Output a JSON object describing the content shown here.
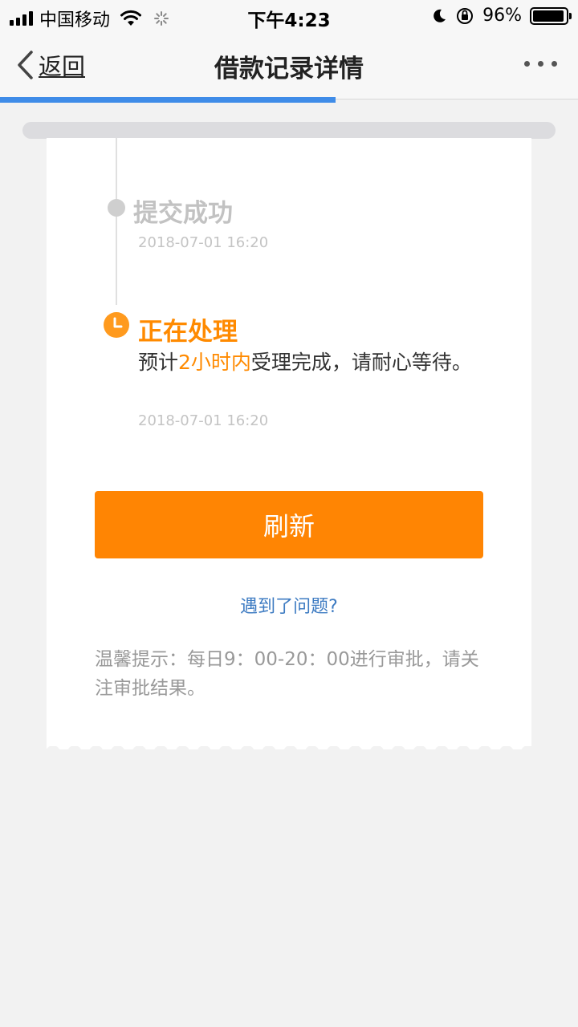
{
  "status_bar": {
    "carrier": "中国移动",
    "time": "下午4:23",
    "battery": "96%",
    "battery_level": 0.96,
    "icons": [
      "signal-icon",
      "wifi-icon",
      "loading-icon",
      "moon-icon",
      "orientation-lock-icon",
      "battery-icon"
    ]
  },
  "nav": {
    "back_label": "返回",
    "title": "借款记录详情",
    "more_icon": "more-dots-icon",
    "page_load_progress": 0.58
  },
  "timeline": {
    "steps": [
      {
        "title": "提交成功",
        "time": "2018-07-01 16:20",
        "status": "done",
        "icon": "dot-icon"
      },
      {
        "title": "正在处理",
        "desc_before": "预计",
        "desc_highlight": "2小时内",
        "desc_after": "受理完成，请耐心等待。",
        "time": "2018-07-01 16:20",
        "status": "processing",
        "icon": "clock-icon"
      }
    ]
  },
  "actions": {
    "refresh_label": "刷新",
    "help_link": "遇到了问题?"
  },
  "tip": "温馨提示：每日9：00-20：00进行审批，请关注审批结果。",
  "colors": {
    "accent": "#ff8503",
    "highlight": "#ff8a00",
    "link": "#3d7bc2",
    "progress": "#3f8ce8"
  }
}
